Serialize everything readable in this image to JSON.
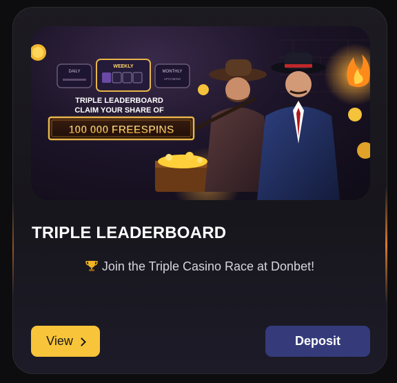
{
  "banner": {
    "tab_daily": "DAILY",
    "tab_weekly": "WEEKLY",
    "tab_monthly": "MONTHLY",
    "tab_monthly_sub": "UPCOMING",
    "headline_1": "TRIPLE LEADERBOARD",
    "headline_2": "CLAIM YOUR SHARE OF",
    "prize": "100 000 FREESPINS"
  },
  "card": {
    "title": "TRIPLE LEADERBOARD",
    "description": "Join the Triple Casino Race at Donbet!",
    "description_icon": "trophy-icon"
  },
  "buttons": {
    "view_label": "View",
    "deposit_label": "Deposit"
  },
  "colors": {
    "view_bg": "#f8c43a",
    "deposit_bg": "#343a7a",
    "card_bg": "#1c1b21"
  }
}
